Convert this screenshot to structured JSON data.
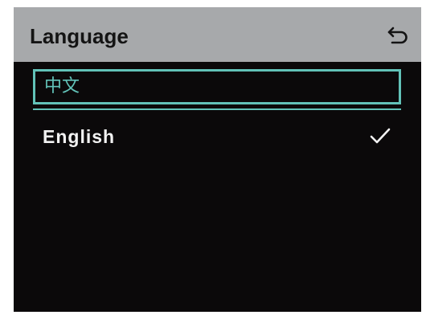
{
  "header": {
    "title": "Language",
    "back_icon": "back-arrow-icon"
  },
  "languages": [
    {
      "label": "中文",
      "focused": true,
      "selected": false
    },
    {
      "label": "English",
      "focused": false,
      "selected": true,
      "indicator_icon": "checkmark-icon"
    }
  ],
  "colors": {
    "header_background": "#a7a9ab",
    "screen_background": "#0b090a",
    "focus_accent": "#62c2b8",
    "text_primary": "#f2f2f2"
  }
}
